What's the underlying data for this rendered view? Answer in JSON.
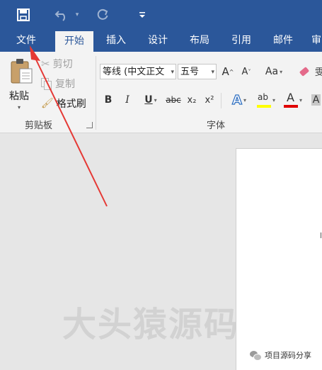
{
  "qat": {
    "customize_label": ""
  },
  "tabs": [
    {
      "label": "文件"
    },
    {
      "label": "开始"
    },
    {
      "label": "插入"
    },
    {
      "label": "设计"
    },
    {
      "label": "布局"
    },
    {
      "label": "引用"
    },
    {
      "label": "邮件"
    },
    {
      "label": "审"
    }
  ],
  "clipboard": {
    "paste_label": "粘贴",
    "cut_label": "剪切",
    "copy_label": "复制",
    "format_painter_label": "格式刷",
    "group_label": "剪贴板"
  },
  "font": {
    "font_name": "等线 (中文正文",
    "font_size": "五号",
    "grow_label": "A",
    "shrink_label": "A",
    "case_label": "Aa",
    "bold_label": "B",
    "italic_label": "I",
    "underline_label": "U",
    "strike_label": "abc",
    "subscript_label": "x₂",
    "superscript_label": "x²",
    "effects_label": "A",
    "highlight_label": "ab",
    "font_color_label": "A",
    "shade_label": "A",
    "group_label": "字体",
    "right_edge_label": "雯"
  },
  "document": {
    "watermark": "大头猿源码",
    "wechat_label": "项目源码分享"
  },
  "colors": {
    "ribbon_blue": "#2b579a",
    "annotation_arrow": "#e53935",
    "highlight_yellow": "#ffff00",
    "font_color_red": "#e00000"
  }
}
